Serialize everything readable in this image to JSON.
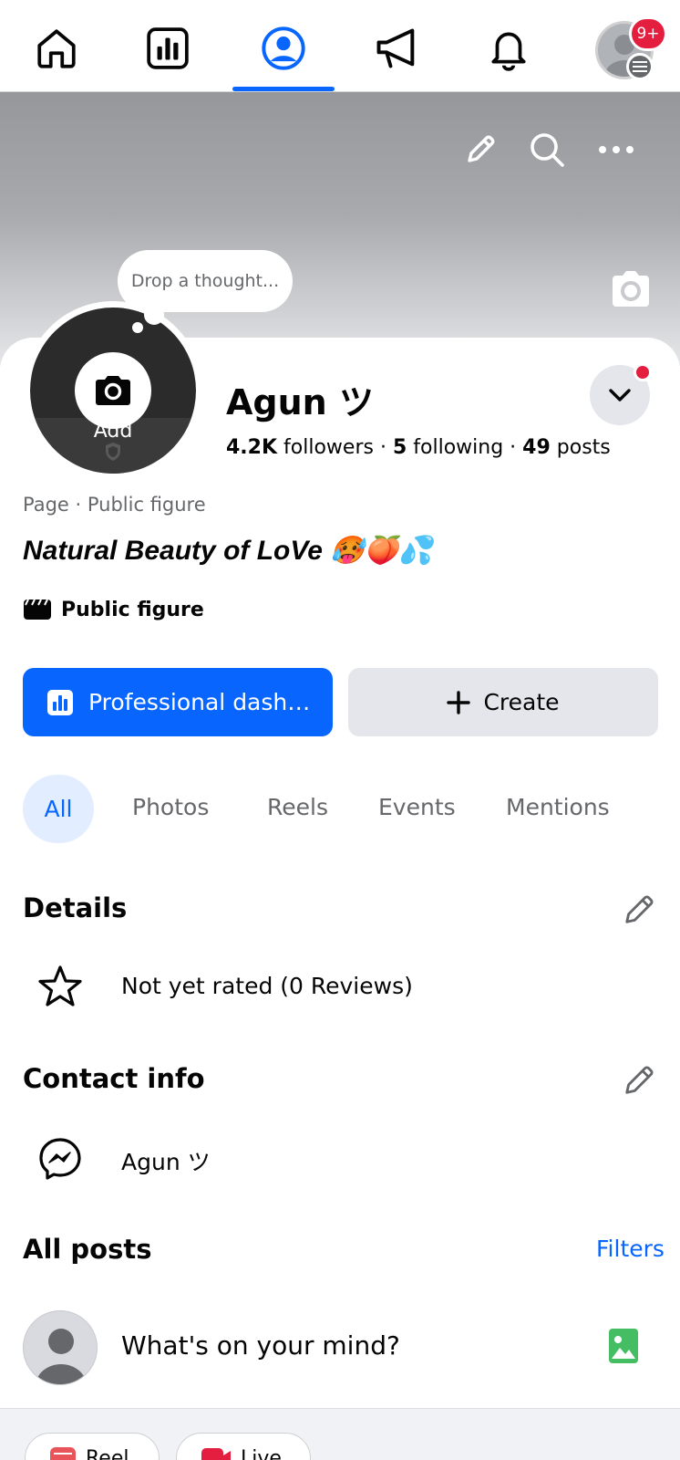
{
  "nav": {
    "items": [
      "home",
      "dashboard",
      "profile",
      "ads",
      "notifications",
      "menu"
    ],
    "notification_badge": "9+",
    "accent": "#0866ff"
  },
  "thought": {
    "placeholder": "Drop a thought..."
  },
  "profile": {
    "add_label": "Add",
    "name": "Agun ツ",
    "followers_count": "4.2K",
    "followers_label": "followers",
    "following_count": "5",
    "following_label": "following",
    "posts_count": "49",
    "posts_label": "posts",
    "separator": " · ",
    "category": "Page · Public figure",
    "bio": "Natural Beauty of LoVe 🥵🍑💦",
    "tag": "Public figure"
  },
  "actions": {
    "professional": "Professional dash…",
    "create": "Create"
  },
  "tabs": [
    "All",
    "Photos",
    "Reels",
    "Events",
    "Mentions"
  ],
  "details": {
    "title": "Details",
    "rating": "Not yet rated (0 Reviews)"
  },
  "contact": {
    "title": "Contact info",
    "messenger": "Agun ツ"
  },
  "posts": {
    "title": "All posts",
    "filters": "Filters",
    "composer_placeholder": "What's on your mind?"
  },
  "bottom_chips": [
    "Reel",
    "Live"
  ]
}
